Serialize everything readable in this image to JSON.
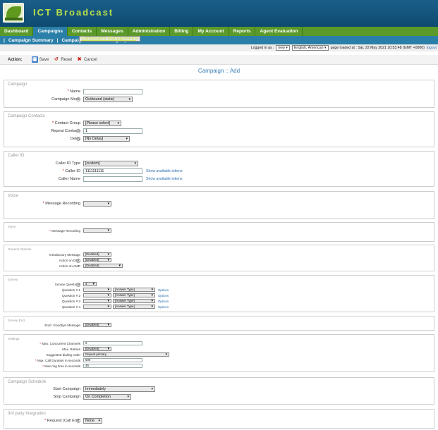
{
  "app": {
    "brand": "ICT Broadcast"
  },
  "nav": [
    "Dashboard",
    "Campaigns",
    "Contacts",
    "Messages",
    "Administration",
    "Billing",
    "My Account",
    "Reports",
    "Agent Evaluation"
  ],
  "subnav": [
    "Campaigns Management",
    "Campaign Summary",
    "Campaign Default Settings"
  ],
  "status": {
    "logged_label": "Logged in as :",
    "user": "new",
    "language": "English, American",
    "loaded": "page loaded at : Sat, 22 May 2021 10:53:48 (GMT +0000)",
    "logout": "logout"
  },
  "actions": {
    "label": "Action:",
    "save": "Save",
    "reset": "Reset",
    "cancel": "Cancel"
  },
  "page_title": "Campaign :: Add",
  "campaign": {
    "title": "Campaign",
    "name_label": "Name",
    "mode_label": "Campaign Mode",
    "mode_value": "Outbound (static)"
  },
  "contacts": {
    "title": "Campaign Contacts",
    "group_label": "Contact Group",
    "group_value": "[Please select]",
    "repeat_label": "Repeat Contacts",
    "repeat_value": "1",
    "delay_label": "Delay",
    "delay_value": "[No Delay]"
  },
  "callerid": {
    "title": "Caller ID",
    "type_label": "Caller ID Type",
    "type_value": "[custom]",
    "id_label": "Caller ID",
    "id_value": "1111111111",
    "name_label": "Caller Name",
    "show_tokens": "Show available tokens"
  },
  "voice": {
    "title": "Voice",
    "recording_label": "Message Recording"
  },
  "general": {
    "title": "General Options",
    "intro_label": "Introductory Message",
    "dnc_label": "Action on DNC",
    "amd_label": "Action on AMD",
    "disabled": "[Disabled]"
  },
  "survey": {
    "title": "Survey",
    "questions_label": "Survey Questions",
    "questions_value": "4",
    "question_labels": [
      "Question # 1",
      "Question # 2",
      "Question # 3",
      "Question # 4"
    ],
    "answer_type": "[Answer Type]",
    "options": "Options"
  },
  "survey_end": {
    "title": "Survey End",
    "goodbye_label": "End / Goodbye Message",
    "goodbye_value": "[Disabled]"
  },
  "settings": {
    "title": "Settings",
    "channels_label": "Max. Concurrent Channels",
    "channels_value": "2",
    "retries_label": "Max. Retries",
    "retries_value": "[Disabled]",
    "order_label": "Suggested dialing order",
    "order_value": "Repeat primary",
    "duration_label": "Max. Call Duration in seconds",
    "duration_value": "600",
    "ring_label": "Max.ring time in seconds",
    "ring_value": "45"
  },
  "schedule": {
    "title": "Campaign Schedule",
    "start_label": "Start Campaign",
    "start_value": "Immediately",
    "stop_label": "Stop Campaign",
    "stop_value": "On Completion"
  },
  "integration": {
    "title": "3rd party Integration",
    "request_label": "Request (Call End)",
    "request_value": "None"
  }
}
